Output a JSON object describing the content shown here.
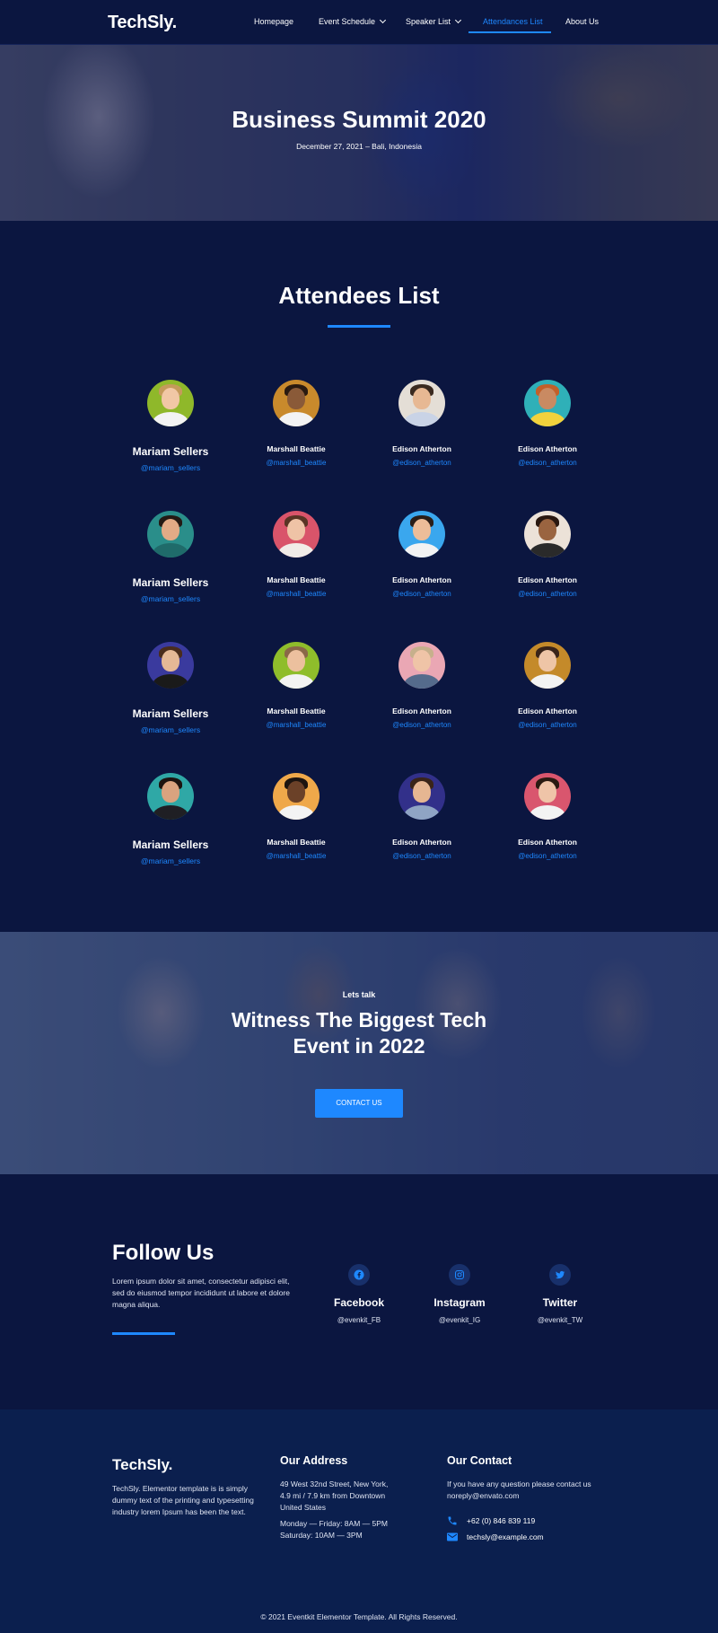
{
  "nav": {
    "logo": "TechSly.",
    "items": [
      {
        "label": "Homepage"
      },
      {
        "label": "Event Schedule"
      },
      {
        "label": "Speaker List"
      },
      {
        "label": "Attendances List"
      },
      {
        "label": "About Us"
      }
    ]
  },
  "hero": {
    "title": "Business Summit 2020",
    "subtitle": "December 27, 2021 – Bali, Indonesia"
  },
  "attendees": {
    "title": "Attendees List",
    "rows": [
      [
        {
          "name": "Mariam Sellers",
          "handle": "@mariam_sellers"
        },
        {
          "name": "Marshall Beattie",
          "handle": "@marshall_beattie"
        },
        {
          "name": "Edison Atherton",
          "handle": "@edison_atherton"
        },
        {
          "name": "Edison Atherton",
          "handle": "@edison_atherton"
        }
      ],
      [
        {
          "name": "Mariam Sellers",
          "handle": "@mariam_sellers"
        },
        {
          "name": "Marshall Beattie",
          "handle": "@marshall_beattie"
        },
        {
          "name": "Edison Atherton",
          "handle": "@edison_atherton"
        },
        {
          "name": "Edison Atherton",
          "handle": "@edison_atherton"
        }
      ],
      [
        {
          "name": "Mariam Sellers",
          "handle": "@mariam_sellers"
        },
        {
          "name": "Marshall Beattie",
          "handle": "@marshall_beattie"
        },
        {
          "name": "Edison Atherton",
          "handle": "@edison_atherton"
        },
        {
          "name": "Edison Atherton",
          "handle": "@edison_atherton"
        }
      ],
      [
        {
          "name": "Mariam Sellers",
          "handle": "@mariam_sellers"
        },
        {
          "name": "Marshall Beattie",
          "handle": "@marshall_beattie"
        },
        {
          "name": "Edison Atherton",
          "handle": "@edison_atherton"
        },
        {
          "name": "Edison Atherton",
          "handle": "@edison_atherton"
        }
      ]
    ]
  },
  "cta": {
    "eyebrow": "Lets talk",
    "title": "Witness The Biggest Tech Event in 2022",
    "button": "CONTACT US"
  },
  "follow": {
    "title": "Follow Us",
    "text": "Lorem ipsum dolor sit amet, consectetur adipisci elit, sed do eiusmod tempor incididunt ut labore et dolore magna aliqua.",
    "socials": [
      {
        "name": "Facebook",
        "handle": "@evenkit_FB",
        "icon": "facebook-icon"
      },
      {
        "name": "Instagram",
        "handle": "@evenkit_IG",
        "icon": "instagram-icon"
      },
      {
        "name": "Twitter",
        "handle": "@evenkit_TW",
        "icon": "twitter-icon"
      }
    ]
  },
  "footer": {
    "logo": "TechSly.",
    "about": "TechSly. Elementor template is is simply dummy text of the printing and typesetting industry lorem Ipsum has been the text.",
    "address_title": "Our Address",
    "address": "49 West 32nd Street, New York, 4.9 mi / 7.9 km from Downtown United States",
    "hours1": "Monday — Friday: 8AM — 5PM",
    "hours2": "Saturday: 10AM — 3PM",
    "contact_title": "Our Contact",
    "contact_text": "If you have any question please contact us noreply@envato.com",
    "phone": "+62 (0) 846 839 119",
    "email": "techsly@example.com",
    "copyright": "© 2021 Eventkit Elementor Template. All Rights Reserved."
  },
  "colors": {
    "background": "#0b1640",
    "accent": "#1e88ff",
    "footer": "#0b1f4e"
  }
}
